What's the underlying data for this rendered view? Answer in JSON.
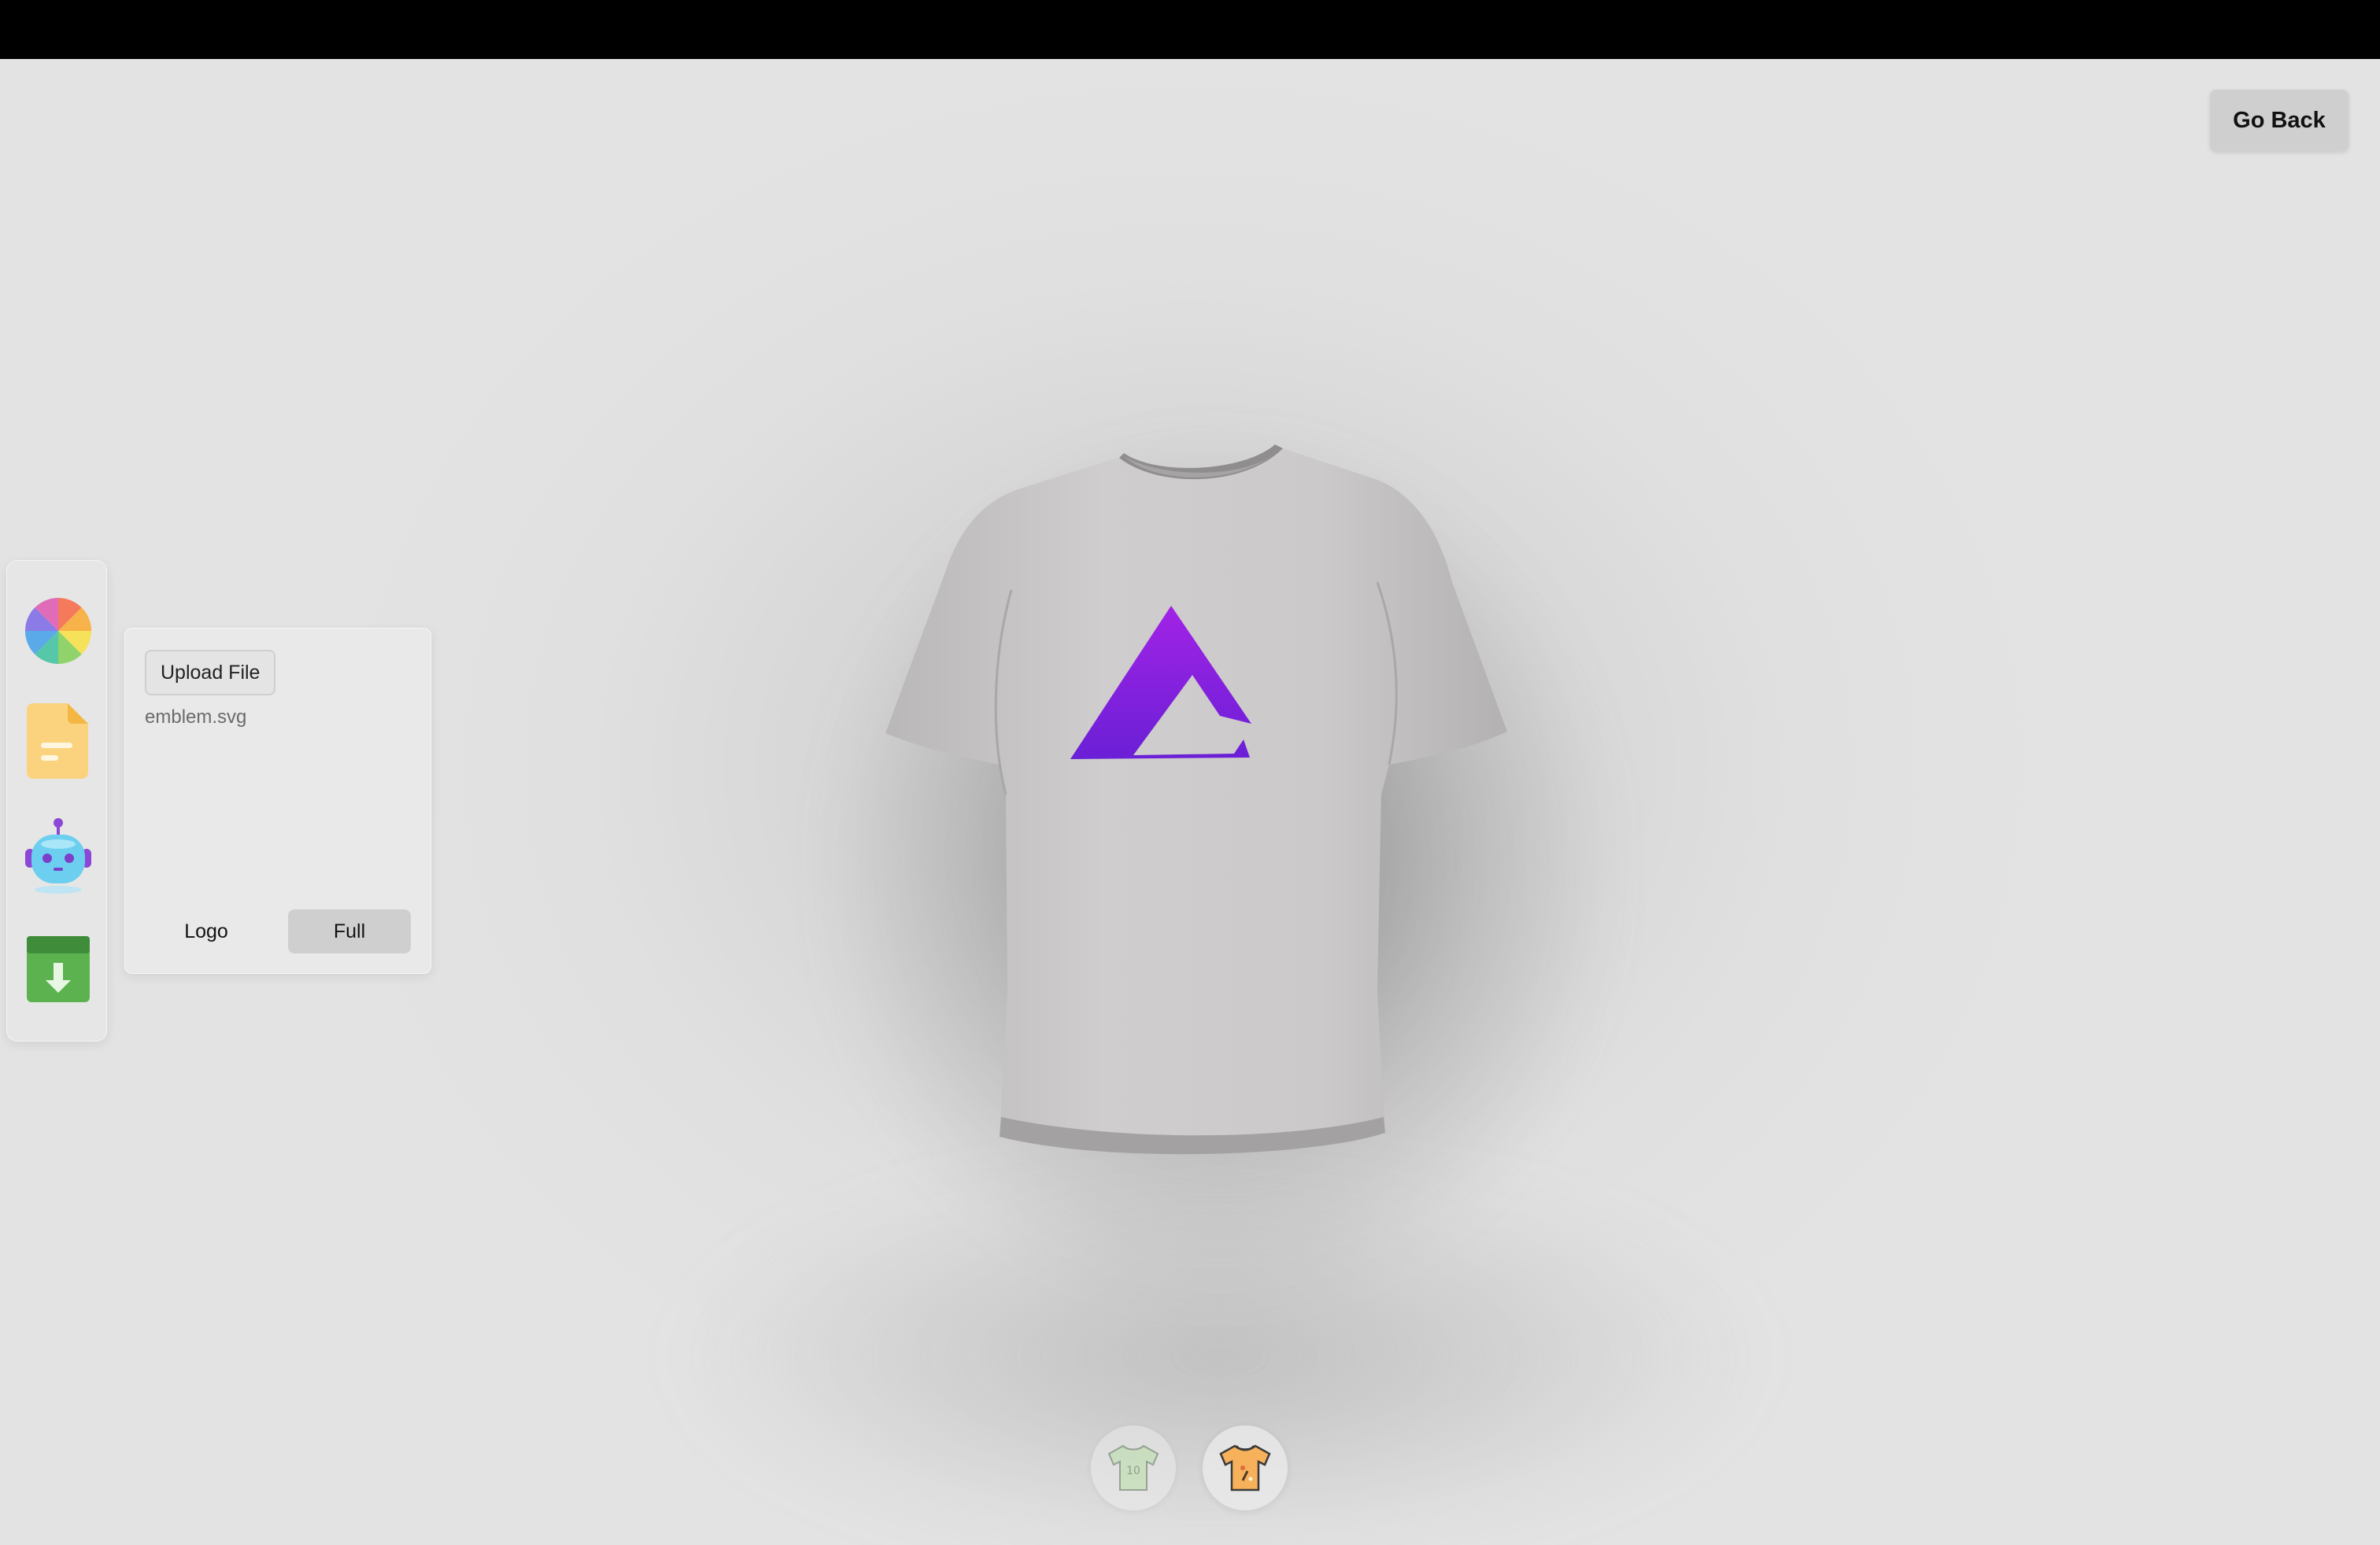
{
  "header": {
    "go_back_label": "Go Back"
  },
  "toolbar": {
    "items": [
      {
        "name": "color-picker",
        "icon": "color-wheel-icon"
      },
      {
        "name": "file-picker",
        "icon": "file-icon"
      },
      {
        "name": "ai-picker",
        "icon": "robot-icon"
      },
      {
        "name": "download",
        "icon": "download-box-icon"
      }
    ]
  },
  "file_panel": {
    "upload_label": "Upload File",
    "filename": "emblem.svg",
    "logo_label": "Logo",
    "full_label": "Full",
    "active_tab": "Full"
  },
  "canvas": {
    "shirt_color": "#c9c7c7",
    "decal_color": "#8a22e0",
    "decal_icon": "triangle-logo-icon"
  },
  "filter_tabs": [
    {
      "name": "logo-shirt",
      "icon": "shirt-number-icon",
      "number": "10"
    },
    {
      "name": "stylish-shirt",
      "icon": "shirt-pattern-icon"
    }
  ]
}
